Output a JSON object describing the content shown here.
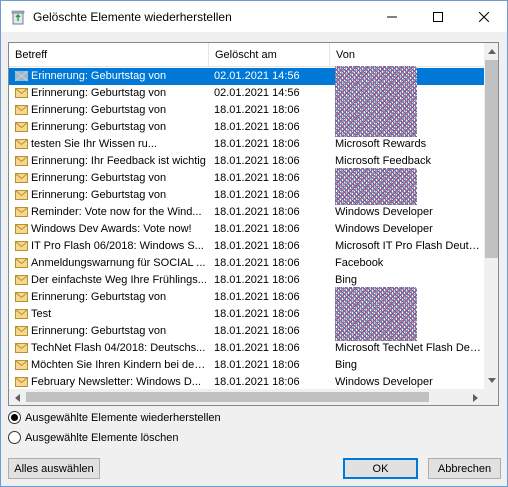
{
  "window": {
    "title": "Gelöschte Elemente wiederherstellen"
  },
  "columns": [
    "Betreff",
    "Gelöscht am",
    "Von"
  ],
  "rows": [
    {
      "subject": "Erinnerung: Geburtstag von",
      "date": "02.01.2021 14:56",
      "from": "",
      "blurred": true,
      "selected": true
    },
    {
      "subject": "Erinnerung: Geburtstag von",
      "date": "02.01.2021 14:56",
      "from": "",
      "blurred": true
    },
    {
      "subject": "Erinnerung: Geburtstag von",
      "date": "18.01.2021 18:06",
      "from": "",
      "blurred": true
    },
    {
      "subject": "Erinnerung: Geburtstag von",
      "date": "18.01.2021 18:06",
      "from": "",
      "blurred": true
    },
    {
      "subject": "testen Sie Ihr Wissen ru...",
      "date": "18.01.2021 18:06",
      "from": "Microsoft Rewards"
    },
    {
      "subject": "Erinnerung: Ihr Feedback ist wichtig",
      "date": "18.01.2021 18:06",
      "from": "Microsoft Feedback"
    },
    {
      "subject": "Erinnerung: Geburtstag von",
      "date": "18.01.2021 18:06",
      "from": "",
      "blurred": true
    },
    {
      "subject": "Erinnerung: Geburtstag von",
      "date": "18.01.2021 18:06",
      "from": "",
      "blurred": true
    },
    {
      "subject": "Reminder: Vote now for the Wind...",
      "date": "18.01.2021 18:06",
      "from": "Windows Developer"
    },
    {
      "subject": "Windows Dev Awards: Vote now!",
      "date": "18.01.2021 18:06",
      "from": "Windows Developer"
    },
    {
      "subject": "IT Pro Flash 06/2018: Windows S...",
      "date": "18.01.2021 18:06",
      "from": "Microsoft IT Pro Flash Deutschl"
    },
    {
      "subject": "Anmeldungswarnung für SOCIAL ...",
      "date": "18.01.2021 18:06",
      "from": "Facebook"
    },
    {
      "subject": "Der einfachste Weg Ihre Frühlings...",
      "date": "18.01.2021 18:06",
      "from": "Bing"
    },
    {
      "subject": "Erinnerung: Geburtstag von",
      "date": "18.01.2021 18:06",
      "from": "",
      "blurred": true
    },
    {
      "subject": "Test",
      "date": "18.01.2021 18:06",
      "from": "",
      "blurred": true
    },
    {
      "subject": "Erinnerung: Geburtstag von",
      "date": "18.01.2021 18:06",
      "from": "",
      "blurred": true
    },
    {
      "subject": "TechNet Flash 04/2018: Deutschs...",
      "date": "18.01.2021 18:06",
      "from": "Microsoft TechNet Flash Deutsc"
    },
    {
      "subject": "Möchten Sie Ihren Kindern bei den...",
      "date": "18.01.2021 18:06",
      "from": "Bing"
    },
    {
      "subject": "February Newsletter: Windows D...",
      "date": "18.01.2021 18:06",
      "from": "Windows Developer"
    }
  ],
  "options": {
    "restore_label": "Ausgewählte Elemente wiederherstellen",
    "delete_label": "Ausgewählte Elemente löschen",
    "selected": "restore"
  },
  "buttons": {
    "select_all": "Alles auswählen",
    "ok": "OK",
    "cancel": "Abbrechen"
  },
  "colors": {
    "selection": "#0078d7",
    "accent": "#0078d7"
  },
  "icons": {
    "app": "recycle-icon",
    "mail": "envelope-icon"
  }
}
